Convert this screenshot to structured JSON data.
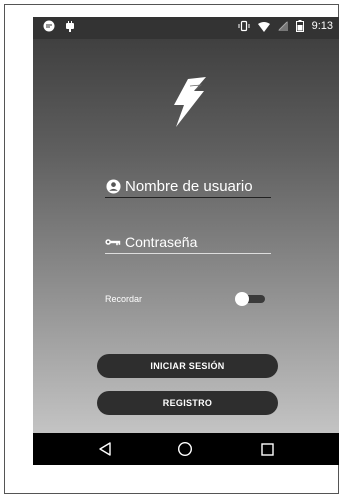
{
  "statusbar": {
    "time": "9:13",
    "icons": [
      "message-icon",
      "android-icon",
      "vibrate-icon",
      "wifi-icon",
      "signal-icon",
      "battery-icon"
    ]
  },
  "login": {
    "username_placeholder": "Nombre de usuario",
    "password_placeholder": "Contraseña",
    "remember_label": "Recordar",
    "remember_on": false,
    "login_button": "INICIAR SESIÓN",
    "register_button": "REGISTRO"
  },
  "navbar": {
    "icons": [
      "back-icon",
      "home-icon",
      "recents-icon"
    ]
  },
  "colors": {
    "button_bg": "#2e2e2e",
    "statusbar_bg": "#333333",
    "navbar_bg": "#000000"
  }
}
